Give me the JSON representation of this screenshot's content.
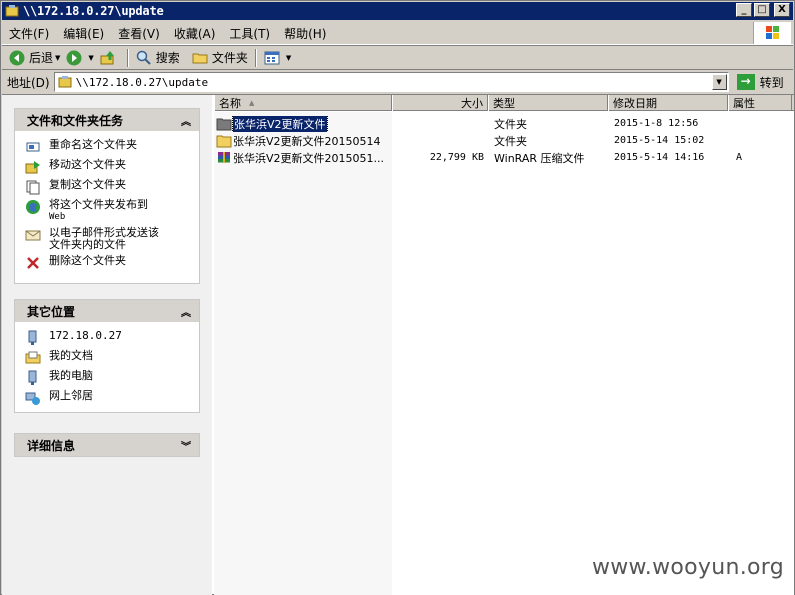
{
  "window": {
    "title": "\\\\172.18.0.27\\update",
    "minimize_label": "_",
    "maximize_label": "□",
    "close_label": "X"
  },
  "menu": [
    "文件(F)",
    "编辑(E)",
    "查看(V)",
    "收藏(A)",
    "工具(T)",
    "帮助(H)"
  ],
  "toolbar": {
    "back": "后退",
    "search": "搜索",
    "folders": "文件夹"
  },
  "address": {
    "label": "地址(D)",
    "value": "\\\\172.18.0.27\\update",
    "go": "转到"
  },
  "tasks_panel": {
    "title": "文件和文件夹任务",
    "items": [
      {
        "label": "重命名这个文件夹",
        "icon": "rename-icon"
      },
      {
        "label": "移动这个文件夹",
        "icon": "move-icon"
      },
      {
        "label": "复制这个文件夹",
        "icon": "copy-icon"
      },
      {
        "label": "将这个文件夹发布到",
        "sub": "Web",
        "icon": "publish-web-icon"
      },
      {
        "label": "以电子邮件形式发送该",
        "sub": "文件夹内的文件",
        "icon": "email-icon"
      },
      {
        "label": "删除这个文件夹",
        "icon": "delete-icon"
      }
    ]
  },
  "places_panel": {
    "title": "其它位置",
    "items": [
      {
        "label": "172.18.0.27",
        "icon": "network-computer-icon"
      },
      {
        "label": "我的文档",
        "icon": "my-documents-icon"
      },
      {
        "label": "我的电脑",
        "icon": "my-computer-icon"
      },
      {
        "label": "网上邻居",
        "icon": "network-places-icon"
      }
    ]
  },
  "details_panel": {
    "title": "详细信息"
  },
  "columns": {
    "name": "名称",
    "size": "大小",
    "type": "类型",
    "modified": "修改日期",
    "attributes": "属性"
  },
  "files": [
    {
      "name": "张华浜V2更新文件",
      "size": "",
      "type": "文件夹",
      "modified": "2015-1-8 12:56",
      "attributes": "",
      "icon": "folder-icon",
      "selected": true
    },
    {
      "name": "张华浜V2更新文件20150514",
      "size": "",
      "type": "文件夹",
      "modified": "2015-5-14 15:02",
      "attributes": "",
      "icon": "folder-icon",
      "selected": false
    },
    {
      "name": "张华浜V2更新文件2015051...",
      "size": "22,799 KB",
      "type": "WinRAR 压缩文件",
      "modified": "2015-5-14 14:16",
      "attributes": "A",
      "icon": "winrar-archive-icon",
      "selected": false
    }
  ],
  "watermark": "www.wooyun.org"
}
